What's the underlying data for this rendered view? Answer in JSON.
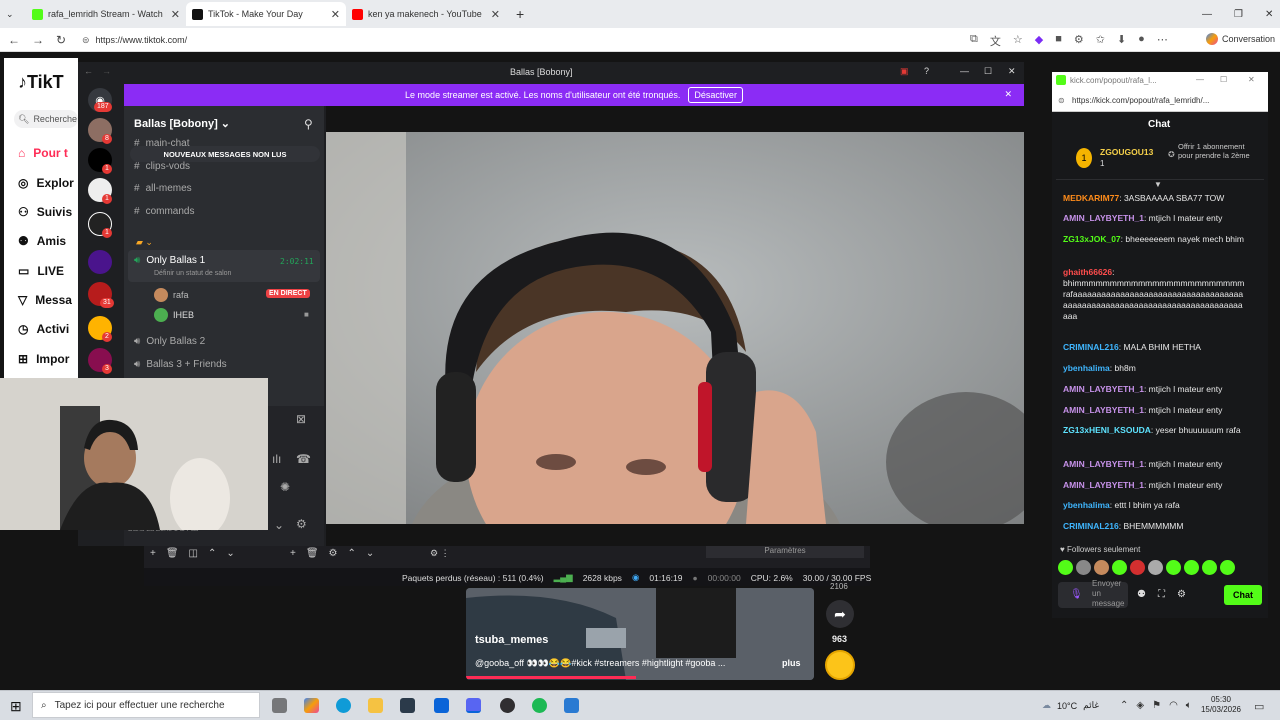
{
  "browser": {
    "tabs": [
      {
        "label": "rafa_lemridh Stream - Watch Live",
        "color": "#53fc18"
      },
      {
        "label": "TikTok - Make Your Day",
        "color": "#111111"
      },
      {
        "label": "ken ya makenech - YouTube",
        "color": "#ff0000"
      }
    ],
    "url": "https://www.tiktok.com/",
    "conversation_label": "Conversation"
  },
  "tiktok": {
    "logo": "TikT",
    "search_placeholder": "Recherche",
    "nav": [
      "Pour t",
      "Explor",
      "Suivis",
      "Amis",
      "LIVE",
      "Messa",
      "Activi",
      "Impor"
    ]
  },
  "discord": {
    "window_title": "Ballas [Bobony]",
    "banner_text": "Le mode streamer est activé. Les noms d'utilisateur ont été tronqués.",
    "banner_button": "Désactiver",
    "server_name": "Ballas [Bobony]",
    "unread_label": "NOUVEAUX MESSAGES NON LUS",
    "channels": [
      "main-chat",
      "clips-vods",
      "all-memes",
      "commands"
    ],
    "voice": {
      "name": "Only Ballas 1",
      "timer": "2:02:11",
      "status": "Définir un statut de salon",
      "members": [
        {
          "name": "rafa",
          "badge": "EN DIRECT"
        },
        {
          "name": "IHEB"
        }
      ]
    },
    "other_voice": [
      "Only Ballas 2",
      "Ballas 3 + Friends"
    ],
    "user_footer": "Dans La Zone 1 & Pas",
    "server_badges": [
      "187",
      "8",
      "1",
      "1",
      "1",
      "31",
      "2",
      "3"
    ]
  },
  "obs": {
    "dropped": "Paquets perdus (réseau) : 511 (0.4%)",
    "bitrate": "2628 kbps",
    "stream_time": "01:16:19",
    "rec_time": "00:00:00",
    "cpu": "CPU: 2.6%",
    "fps": "30.00 / 30.00 FPS",
    "settings_label": "Paramètres"
  },
  "tiktok_card": {
    "count": "963",
    "count_top": "2106",
    "author": "tsuba_memes",
    "caption": "@gooba_off 👀👀😂😂#kick #streamers #hightlight #gooba ...",
    "more": "plus"
  },
  "kick": {
    "window_url": "kick.com/popout/rafa_l...",
    "url": "https://kick.com/popout/rafa_lemridh/...",
    "title": "Chat",
    "gift_user": "ZGOUGOU13",
    "gift_count": "1",
    "gift_text": "Offrir 1 abonnement pour prendre la 2ème",
    "messages": [
      {
        "user": "MEDKARIM77",
        "text": "3ASBAAAAA SBA77 TOW",
        "color": "#ff8c1a"
      },
      {
        "user": "AMIN_LAYBYETH_1",
        "text": "mtjich l mateur enty",
        "color": "#c792ea"
      },
      {
        "user": "ZG13xJOK_07",
        "text": "bheeeeeeem nayek mech bhim",
        "color": "#53fc18"
      },
      {
        "user": "ghaith66626",
        "text": "bhimmmmmmmmmmmmmmmmmmmmmmmm rafaaaaaaaaaaaaaaaaaaaaaaaaaaaaaaaaaaaa aaaaaaaaaaaaaaaaaaaaaaaaaaaaaaaaaaaaaa aaa",
        "color": "#ff4d4d"
      },
      {
        "user": "CRIMINAL216",
        "text": "MALA BHIM HETHA",
        "color": "#3fb6ff"
      },
      {
        "user": "ybenhalima",
        "text": "bh8m",
        "color": "#3fb6ff"
      },
      {
        "user": "AMIN_LAYBYETH_1",
        "text": "mtjich l mateur enty",
        "color": "#c792ea"
      },
      {
        "user": "AMIN_LAYBYETH_1",
        "text": "mtjich l mateur enty",
        "color": "#c792ea"
      },
      {
        "user": "ZG13xHENI_KSOUDA",
        "text": "yeser bhuuuuuum rafa",
        "color": "#5ee3ff"
      },
      {
        "user": "AMIN_LAYBYETH_1",
        "text": "mtjich l mateur enty",
        "color": "#c792ea"
      },
      {
        "user": "AMIN_LAYBYETH_1",
        "text": "mtjich l mateur enty",
        "color": "#c792ea"
      },
      {
        "user": "ybenhalima",
        "text": "ettt l bhim ya rafa",
        "color": "#3fb6ff"
      },
      {
        "user": "CRIMINAL216",
        "text": "BHEMMMMMM",
        "color": "#3fb6ff"
      }
    ],
    "followers_only": "Followers seulement",
    "input_placeholder": "Envoyer un message",
    "send_button": "Chat"
  },
  "taskbar": {
    "search_placeholder": "Tapez ici pour effectuer une recherche",
    "weather": "10°C",
    "weather_text": "غائم",
    "time": "05:30",
    "date": "15/03/2026"
  }
}
